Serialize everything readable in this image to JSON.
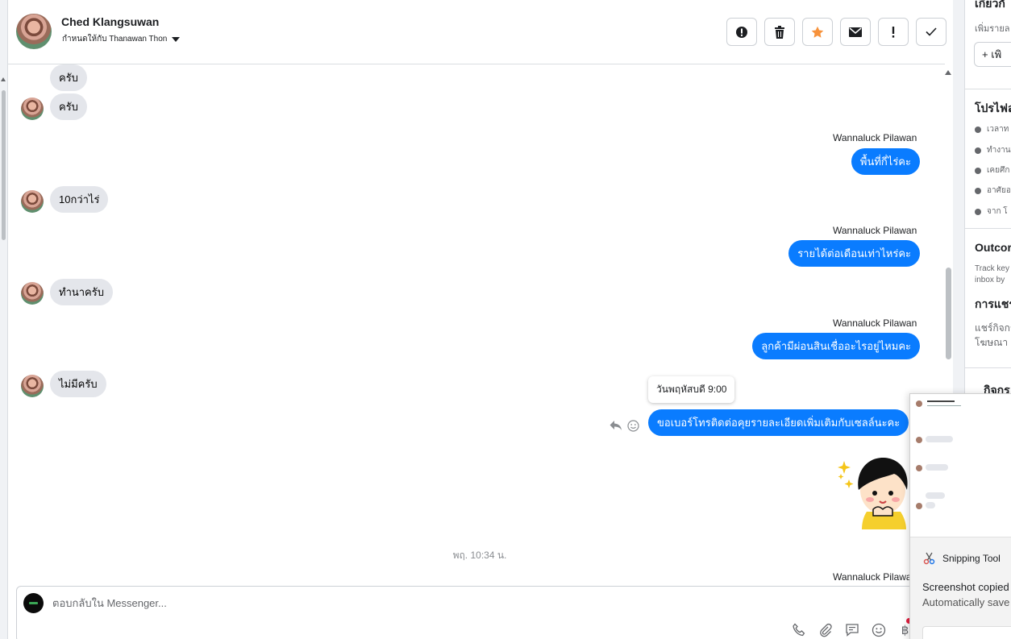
{
  "header": {
    "contact_name": "Ched Klangsuwan",
    "assigned_label": "กำหนดให้กับ Thanawan Thon"
  },
  "toolbar": {
    "buttons": [
      "info-icon",
      "trash-icon",
      "star-icon",
      "mail-icon",
      "exclamation-icon",
      "check-icon"
    ],
    "star_color": "#f7923b"
  },
  "messages": {
    "in_0": "ครับ",
    "in_1": "ครับ",
    "in_2": "10กว่าไร่",
    "in_3": "ทำนาครับ",
    "in_4": "ไม่มีครับ",
    "sender": "Wannaluck Pilawan",
    "out_1": "พื้นที่กี่ไร่คะ",
    "out_2": "รายได้ต่อเดือนเท่าไหร่คะ",
    "out_3": "ลูกค้ามีผ่อนสินเชื่ออะไรอยู่ไหมคะ",
    "out_4": "ขอเบอร์โทรติดต่อคุยรายละเอียดเพิ่มเติมกับเซลล์นะคะ",
    "tooltip": "วันพฤหัสบดี 9:00",
    "timestamp": "พฤ. 10:34 น.",
    "cut_sender": "Wannaluck Pilawan"
  },
  "composer": {
    "placeholder": "ตอบกลับใน Messenger...",
    "icons": [
      "phone-icon",
      "attachment-icon",
      "saved-reply-icon",
      "emoji-icon",
      "baht-icon"
    ],
    "baht_symbol": "฿"
  },
  "right_panel": {
    "about_title": "เกี่ยวกั",
    "about_sub": "เพิ่มรายล",
    "add_button": "เพิ",
    "profile_title": "โปรไฟล",
    "profile_rows": [
      "เวลาท",
      "ทำงาน",
      "เคยศึก",
      "อาศัยอ",
      "จาก โ"
    ],
    "outcome_title": "Outcor",
    "outcome_desc_1": "Track key",
    "outcome_desc_2": "inbox by",
    "share_title": "การแชร",
    "share_desc_1": "แชร์กิจกร",
    "share_desc_2": "โฆษณา",
    "activity_title": "กิจกร"
  },
  "snipping_tool": {
    "app_name": "Snipping Tool",
    "message_1": "Screenshot copied",
    "message_2": "Automatically save"
  },
  "colors": {
    "outgoing_bubble": "#0a7cff",
    "incoming_bubble": "#e4e6eb"
  }
}
